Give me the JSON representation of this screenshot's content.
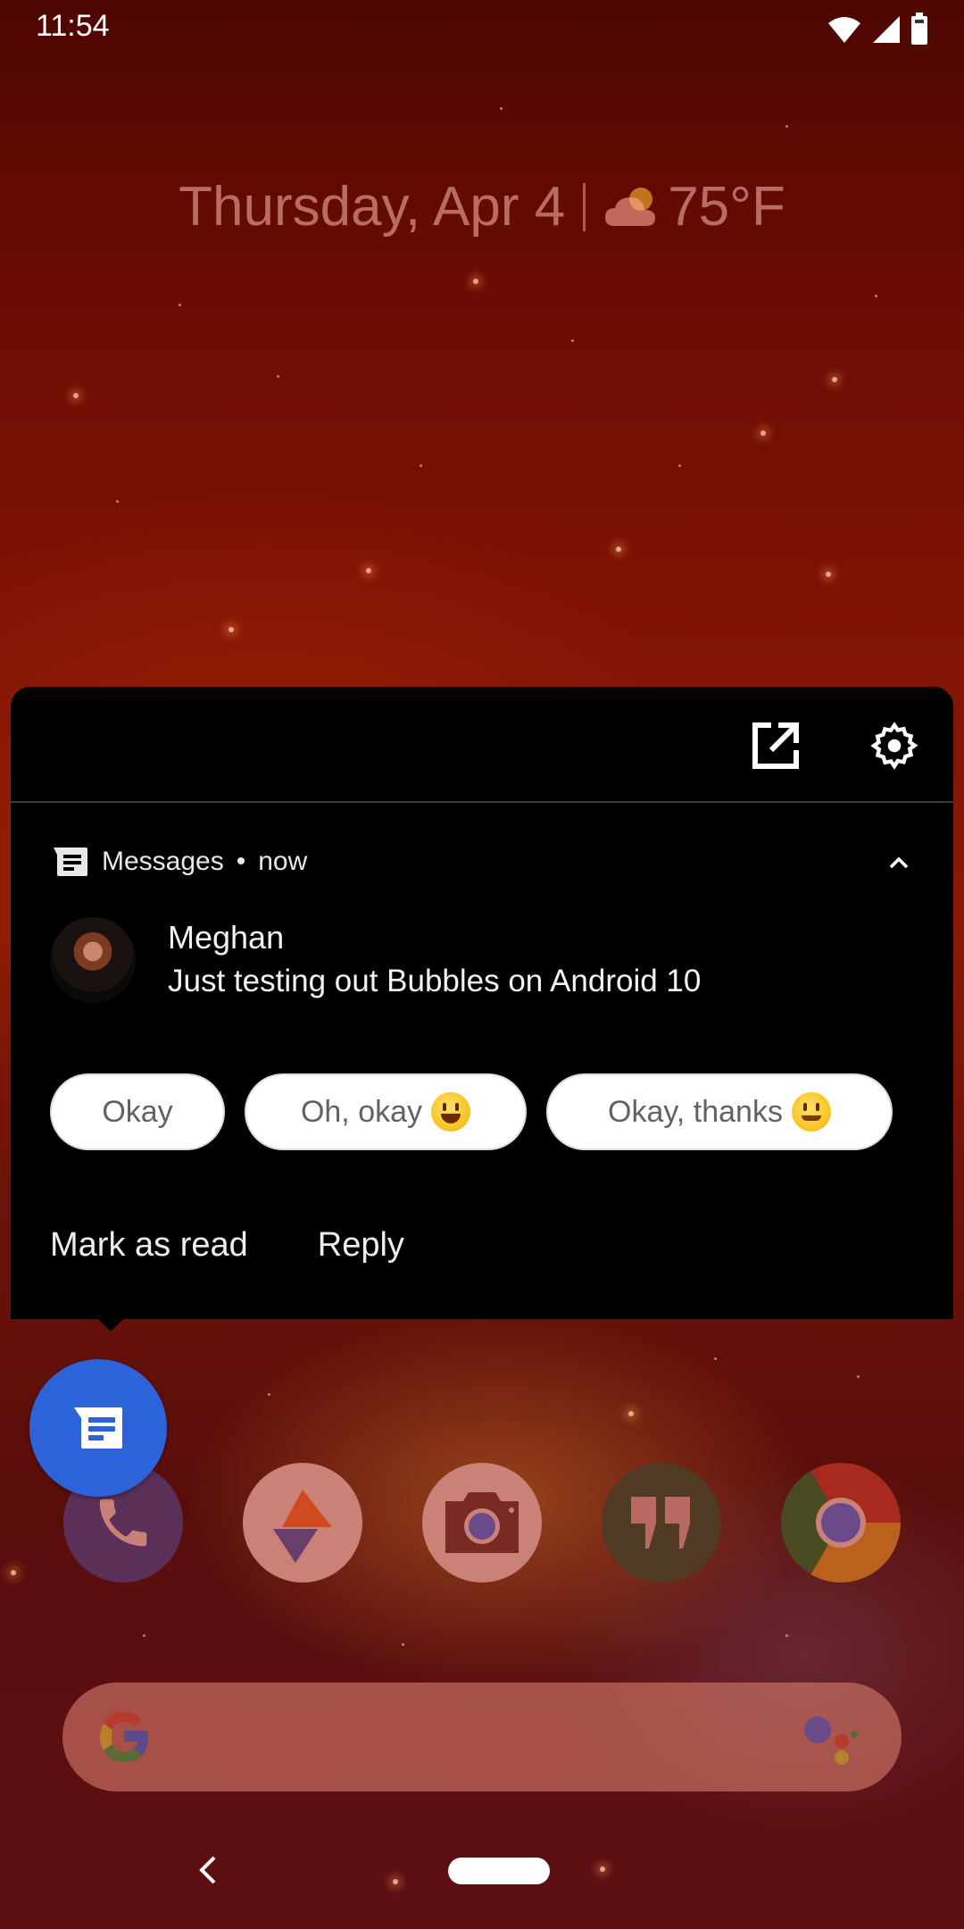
{
  "status_bar": {
    "time": "11:54",
    "icons": [
      "wifi-icon",
      "cell-signal-icon",
      "battery-icon"
    ]
  },
  "at_a_glance": {
    "date": "Thursday, Apr 4",
    "weather_icon": "partly-cloudy-icon",
    "temperature": "75°F"
  },
  "bubble_panel": {
    "header_icons": [
      "open-in-app-icon",
      "settings-gear-icon"
    ],
    "notification": {
      "app_icon": "messages-icon",
      "app_name": "Messages",
      "separator": "•",
      "time": "now",
      "sender": "Meghan",
      "message": "Just testing out Bubbles on Android 10",
      "smart_replies": [
        {
          "label": "Okay",
          "emoji": ""
        },
        {
          "label": "Oh, okay",
          "emoji": "grinning-face"
        },
        {
          "label": "Okay, thanks",
          "emoji": "smiling-face-with-smiling-eyes"
        }
      ],
      "actions": [
        "Mark as read",
        "Reply"
      ]
    }
  },
  "bubble": {
    "app": "Messages",
    "icon": "messages-icon",
    "color": "#2d63d8"
  },
  "dock": {
    "apps": [
      {
        "name": "Phone",
        "icon": "phone-icon"
      },
      {
        "name": "Maps-like app",
        "icon": "triangle-app-icon"
      },
      {
        "name": "Camera",
        "icon": "camera-icon"
      },
      {
        "name": "Hangouts",
        "icon": "hangouts-icon"
      },
      {
        "name": "Chrome",
        "icon": "chrome-icon"
      }
    ]
  },
  "search_bar": {
    "left_icon": "google-g-icon",
    "right_icon": "assistant-icon"
  },
  "nav_bar": {
    "buttons": [
      "back",
      "home"
    ]
  }
}
